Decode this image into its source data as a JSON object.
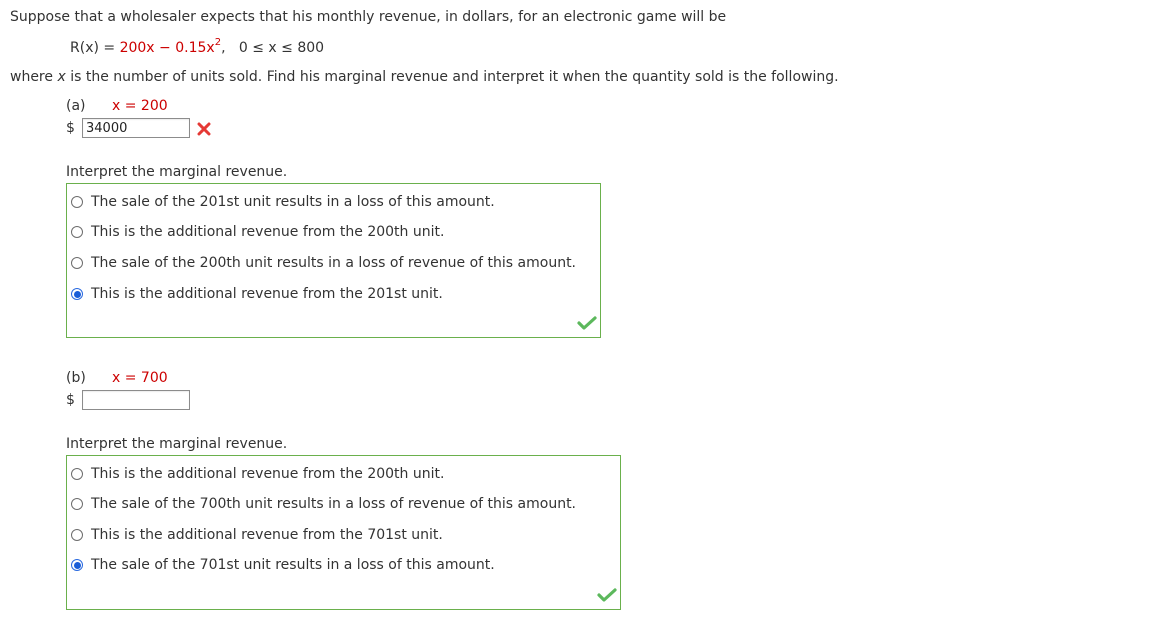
{
  "intro": {
    "line1": "Suppose that a wholesaler expects that his monthly revenue, in dollars, for an electronic game will be",
    "formula_lhs": "R(x) = ",
    "formula_rhs_a": "200x − 0.15x",
    "formula_exp": "2",
    "formula_comma": ",",
    "formula_domain": "0 ≤ x ≤ 800",
    "line2_a": "where ",
    "line2_x": "x",
    "line2_b": " is the number of units sold. Find his marginal revenue and interpret it when the quantity sold is the following."
  },
  "part_a": {
    "label": "(a)",
    "x_text": "x = 200",
    "currency": "$",
    "input_value": "34000",
    "interpret_label": "Interpret the marginal revenue.",
    "options": [
      "The sale of the 201st unit results in a loss of this amount.",
      "This is the additional revenue from the 200th unit.",
      "The sale of the 200th unit results in a loss of revenue of this amount.",
      "This is the additional revenue from the 201st unit."
    ],
    "selected_index": 3
  },
  "part_b": {
    "label": "(b)",
    "x_text": "x = 700",
    "currency": "$",
    "input_value": "",
    "interpret_label": "Interpret the marginal revenue.",
    "options": [
      "This is the additional revenue from the 200th unit.",
      "The sale of the 700th unit results in a loss of revenue of this amount.",
      "This is the additional revenue from the 701st unit.",
      "The sale of the 701st unit results in a loss of this amount."
    ],
    "selected_index": 3
  },
  "colors": {
    "correct": "#5cb85c",
    "incorrect": "#e53935",
    "selected_radio": "#1a5ed8",
    "accent_text": "#cc0000"
  },
  "icons": {
    "incorrect": "x-mark-icon",
    "correct": "checkmark-icon"
  }
}
